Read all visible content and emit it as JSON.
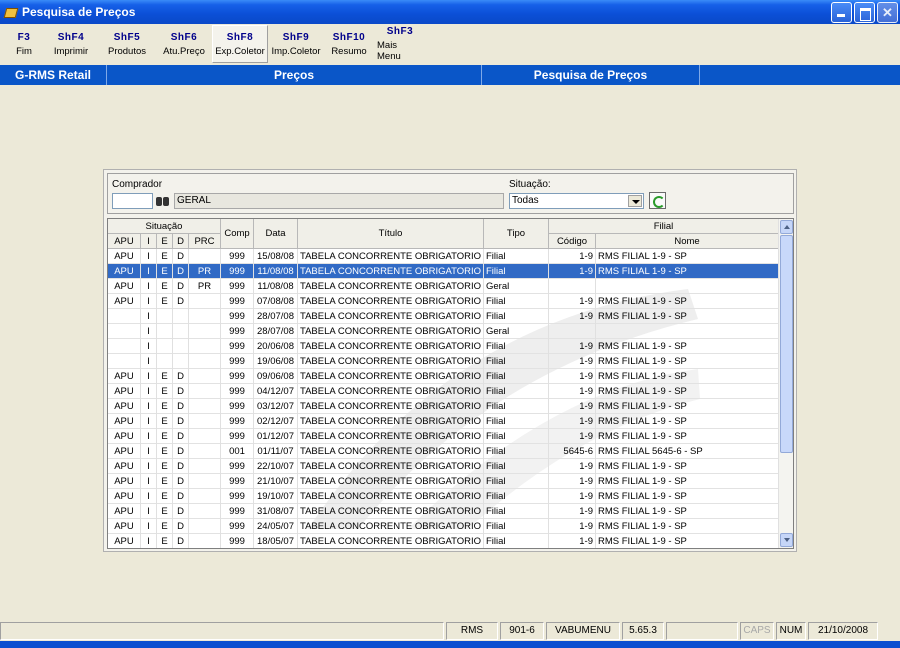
{
  "window": {
    "title": "Pesquisa de Preços"
  },
  "toolbar": [
    {
      "key": "F3",
      "label": "Fim"
    },
    {
      "key": "ShF4",
      "label": "Imprimir"
    },
    {
      "key": "ShF5",
      "label": "Produtos"
    },
    {
      "key": "ShF6",
      "label": "Atu.Preço"
    },
    {
      "key": "ShF8",
      "label": "Exp.Coletor"
    },
    {
      "key": "ShF9",
      "label": "Imp.Coletor"
    },
    {
      "key": "ShF10",
      "label": "Resumo"
    },
    {
      "key": "ShF3",
      "label": "Mais Menu"
    }
  ],
  "header": {
    "app": "G-RMS Retail",
    "module": "Preços",
    "screen": "Pesquisa de Preços"
  },
  "filters": {
    "comprador_label": "Comprador",
    "comprador_code": "",
    "comprador_name": "GERAL",
    "situacao_label": "Situação:",
    "situacao_value": "Todas"
  },
  "grid": {
    "group_situacao": "Situação",
    "group_filial": "Filial",
    "cols": {
      "apu": "APU",
      "i": "I",
      "e": "E",
      "d": "D",
      "prc": "PRC",
      "comp": "Comp",
      "data": "Data",
      "titulo": "Título",
      "tipo": "Tipo",
      "codigo": "Código",
      "nome": "Nome"
    },
    "rows": [
      {
        "apu": "APU",
        "i": "I",
        "e": "E",
        "d": "D",
        "prc": "",
        "comp": "999",
        "data": "15/08/08",
        "titulo": "TABELA CONCORRENTE OBRIGATORIO",
        "tipo": "Filial",
        "codigo": "1-9",
        "nome": "RMS FILIAL 1-9 - SP"
      },
      {
        "apu": "APU",
        "i": "I",
        "e": "E",
        "d": "D",
        "prc": "PR",
        "comp": "999",
        "data": "11/08/08",
        "titulo": "TABELA CONCORRENTE OBRIGATORIO",
        "tipo": "Filial",
        "codigo": "1-9",
        "nome": "RMS FILIAL 1-9 - SP",
        "selected": true
      },
      {
        "apu": "APU",
        "i": "I",
        "e": "E",
        "d": "D",
        "prc": "PR",
        "comp": "999",
        "data": "11/08/08",
        "titulo": "TABELA CONCORRENTE OBRIGATORIO",
        "tipo": "Geral",
        "codigo": "",
        "nome": ""
      },
      {
        "apu": "APU",
        "i": "I",
        "e": "E",
        "d": "D",
        "prc": "",
        "comp": "999",
        "data": "07/08/08",
        "titulo": "TABELA CONCORRENTE OBRIGATORIO",
        "tipo": "Filial",
        "codigo": "1-9",
        "nome": "RMS FILIAL 1-9 - SP"
      },
      {
        "apu": "",
        "i": "I",
        "e": "",
        "d": "",
        "prc": "",
        "comp": "999",
        "data": "28/07/08",
        "titulo": "TABELA CONCORRENTE OBRIGATORIO",
        "tipo": "Filial",
        "codigo": "1-9",
        "nome": "RMS FILIAL 1-9 - SP"
      },
      {
        "apu": "",
        "i": "I",
        "e": "",
        "d": "",
        "prc": "",
        "comp": "999",
        "data": "28/07/08",
        "titulo": "TABELA CONCORRENTE OBRIGATORIO",
        "tipo": "Geral",
        "codigo": "",
        "nome": ""
      },
      {
        "apu": "",
        "i": "I",
        "e": "",
        "d": "",
        "prc": "",
        "comp": "999",
        "data": "20/06/08",
        "titulo": "TABELA CONCORRENTE OBRIGATORIO",
        "tipo": "Filial",
        "codigo": "1-9",
        "nome": "RMS FILIAL 1-9 - SP"
      },
      {
        "apu": "",
        "i": "I",
        "e": "",
        "d": "",
        "prc": "",
        "comp": "999",
        "data": "19/06/08",
        "titulo": "TABELA CONCORRENTE OBRIGATORIO",
        "tipo": "Filial",
        "codigo": "1-9",
        "nome": "RMS FILIAL 1-9 - SP"
      },
      {
        "apu": "APU",
        "i": "I",
        "e": "E",
        "d": "D",
        "prc": "",
        "comp": "999",
        "data": "09/06/08",
        "titulo": "TABELA CONCORRENTE OBRIGATORIO",
        "tipo": "Filial",
        "codigo": "1-9",
        "nome": "RMS FILIAL 1-9 - SP"
      },
      {
        "apu": "APU",
        "i": "I",
        "e": "E",
        "d": "D",
        "prc": "",
        "comp": "999",
        "data": "04/12/07",
        "titulo": "TABELA CONCORRENTE OBRIGATORIO",
        "tipo": "Filial",
        "codigo": "1-9",
        "nome": "RMS FILIAL 1-9 - SP"
      },
      {
        "apu": "APU",
        "i": "I",
        "e": "E",
        "d": "D",
        "prc": "",
        "comp": "999",
        "data": "03/12/07",
        "titulo": "TABELA CONCORRENTE OBRIGATORIO",
        "tipo": "Filial",
        "codigo": "1-9",
        "nome": "RMS FILIAL 1-9 - SP"
      },
      {
        "apu": "APU",
        "i": "I",
        "e": "E",
        "d": "D",
        "prc": "",
        "comp": "999",
        "data": "02/12/07",
        "titulo": "TABELA CONCORRENTE OBRIGATORIO",
        "tipo": "Filial",
        "codigo": "1-9",
        "nome": "RMS FILIAL 1-9 - SP"
      },
      {
        "apu": "APU",
        "i": "I",
        "e": "E",
        "d": "D",
        "prc": "",
        "comp": "999",
        "data": "01/12/07",
        "titulo": "TABELA CONCORRENTE OBRIGATORIO",
        "tipo": "Filial",
        "codigo": "1-9",
        "nome": "RMS FILIAL 1-9 - SP"
      },
      {
        "apu": "APU",
        "i": "I",
        "e": "E",
        "d": "D",
        "prc": "",
        "comp": "001",
        "data": "01/11/07",
        "titulo": "TABELA CONCORRENTE OBRIGATORIO",
        "tipo": "Filial",
        "codigo": "5645-6",
        "nome": "RMS FILIAL 5645-6 - SP"
      },
      {
        "apu": "APU",
        "i": "I",
        "e": "E",
        "d": "D",
        "prc": "",
        "comp": "999",
        "data": "22/10/07",
        "titulo": "TABELA CONCORRENTE OBRIGATORIO",
        "tipo": "Filial",
        "codigo": "1-9",
        "nome": "RMS FILIAL 1-9 - SP"
      },
      {
        "apu": "APU",
        "i": "I",
        "e": "E",
        "d": "D",
        "prc": "",
        "comp": "999",
        "data": "21/10/07",
        "titulo": "TABELA CONCORRENTE OBRIGATORIO",
        "tipo": "Filial",
        "codigo": "1-9",
        "nome": "RMS FILIAL 1-9 - SP"
      },
      {
        "apu": "APU",
        "i": "I",
        "e": "E",
        "d": "D",
        "prc": "",
        "comp": "999",
        "data": "19/10/07",
        "titulo": "TABELA CONCORRENTE OBRIGATORIO",
        "tipo": "Filial",
        "codigo": "1-9",
        "nome": "RMS FILIAL 1-9 - SP"
      },
      {
        "apu": "APU",
        "i": "I",
        "e": "E",
        "d": "D",
        "prc": "",
        "comp": "999",
        "data": "31/08/07",
        "titulo": "TABELA CONCORRENTE OBRIGATORIO",
        "tipo": "Filial",
        "codigo": "1-9",
        "nome": "RMS FILIAL 1-9 - SP"
      },
      {
        "apu": "APU",
        "i": "I",
        "e": "E",
        "d": "D",
        "prc": "",
        "comp": "999",
        "data": "24/05/07",
        "titulo": "TABELA CONCORRENTE OBRIGATORIO",
        "tipo": "Filial",
        "codigo": "1-9",
        "nome": "RMS FILIAL 1-9 - SP"
      },
      {
        "apu": "APU",
        "i": "I",
        "e": "E",
        "d": "D",
        "prc": "",
        "comp": "999",
        "data": "18/05/07",
        "titulo": "TABELA CONCORRENTE OBRIGATORIO",
        "tipo": "Filial",
        "codigo": "1-9",
        "nome": "RMS FILIAL 1-9 - SP"
      }
    ]
  },
  "statusbar": {
    "system": "RMS",
    "code": "901-6",
    "user": "VABUMENU",
    "version": "5.65.3",
    "caps": "CAPS",
    "num": "NUM",
    "date": "21/10/2008"
  },
  "colors": {
    "selection": "#316ac5",
    "header_blue": "#0a56c8",
    "key_blue": "#00008b"
  }
}
